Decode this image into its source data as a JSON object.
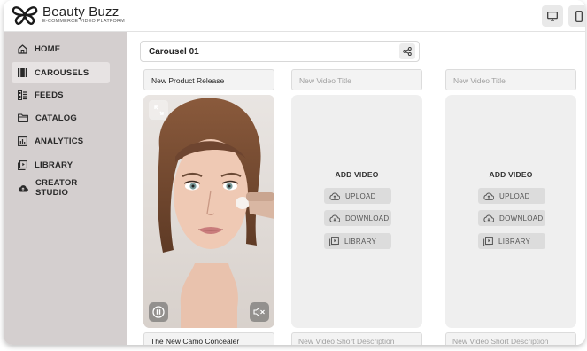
{
  "brand": {
    "name": "Beauty Buzz",
    "tagline": "E-COMMERCE VIDEO PLATFORM"
  },
  "header": {
    "desktop_icon": "monitor-icon",
    "mobile_icon": "phone-icon"
  },
  "sidebar": {
    "items": [
      {
        "label": "HOME",
        "icon": "home-icon",
        "active": false
      },
      {
        "label": "CAROUSELS",
        "icon": "carousels-icon",
        "active": true
      },
      {
        "label": "FEEDS",
        "icon": "feeds-icon",
        "active": false
      },
      {
        "label": "CATALOG",
        "icon": "folder-icon",
        "active": false
      },
      {
        "label": "ANALYTICS",
        "icon": "analytics-icon",
        "active": false
      },
      {
        "label": "LIBRARY",
        "icon": "library-icon",
        "active": false
      },
      {
        "label": "CREATOR STUDIO",
        "icon": "cloud-icon",
        "active": false
      }
    ]
  },
  "main": {
    "carousel_name": "Carousel 01",
    "videos": [
      {
        "title": "New Product Release",
        "description": "The New Camo Concealer"
      },
      {
        "title_placeholder": "New Video Title",
        "add_label": "ADD VIDEO",
        "upload": "UPLOAD",
        "download": "DOWNLOAD",
        "library": "LIBRARY",
        "description_placeholder": "New Video Short Description"
      },
      {
        "title_placeholder": "New Video Title",
        "add_label": "ADD VIDEO",
        "upload": "UPLOAD",
        "download": "DOWNLOAD",
        "library": "LIBRARY",
        "description_placeholder": "New Video Short Description"
      }
    ]
  },
  "colors": {
    "sidebar_bg": "#d4cfcf",
    "sidebar_active": "#e7e3e3",
    "card_bg": "#efefef",
    "button_bg": "#dcdcdc"
  }
}
